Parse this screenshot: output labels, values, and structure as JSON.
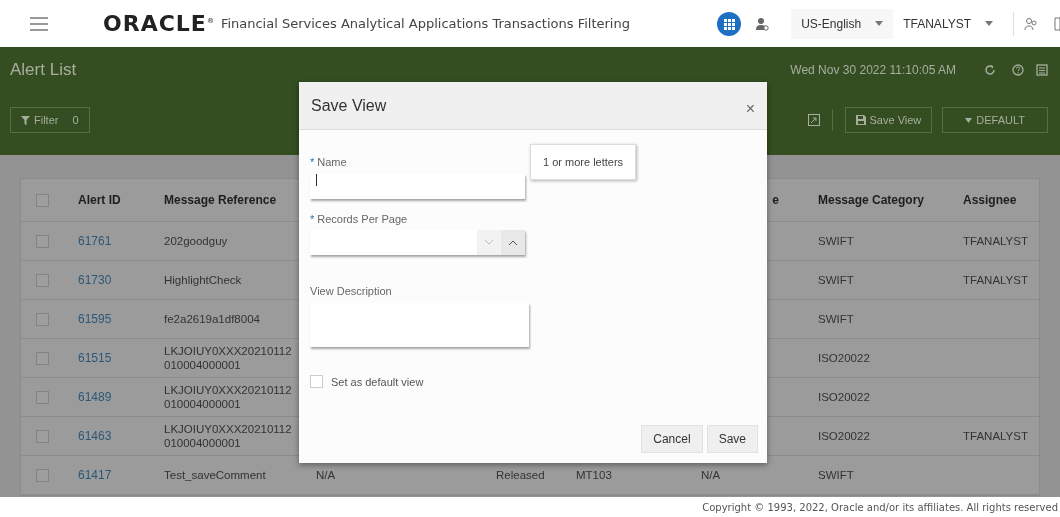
{
  "topbar": {
    "brand": "ORACLE$^{®}$",
    "app_title": "Financial Services Analytical Applications Transactions Filtering",
    "language": "US-English",
    "user": "TFANALYST"
  },
  "header": {
    "title": "Alert List",
    "datetime": "Wed Nov 30 2022 11:10:05 AM",
    "filter": {
      "label": "Filter",
      "count": "0"
    },
    "save_view": "Save View",
    "view_menu": "DEFAULT"
  },
  "table": {
    "select_all": {
      "checked": false
    },
    "columns": {
      "alert_id": "Alert ID",
      "message_reference": "Message Reference",
      "column_7": "e",
      "message_category": "Message Category",
      "assignee": "Assignee"
    },
    "rows": [
      {
        "checked": false,
        "alert_id": "61761",
        "message_reference": "202goodguy",
        "message_category": "SWIFT",
        "assignee": "TFANALYST"
      },
      {
        "checked": false,
        "alert_id": "61730",
        "message_reference": "HighlightCheck",
        "message_category": "SWIFT",
        "assignee": "TFANALYST"
      },
      {
        "checked": false,
        "alert_id": "61595",
        "message_reference": "fe2a2619a1df8004",
        "message_category": "SWIFT"
      },
      {
        "checked": false,
        "alert_id": "61515",
        "message_reference": "LKJOIUY0XXX20210112\n010004000001",
        "message_category": "ISO20022"
      },
      {
        "checked": false,
        "alert_id": "61489",
        "message_reference": "LKJOIUY0XXX20210112\n010004000001",
        "message_category": "ISO20022"
      },
      {
        "checked": false,
        "alert_id": "61463",
        "message_reference": "LKJOIUY0XXX20210112\n010004000001",
        "message_category": "ISO20022",
        "assignee": "TFANALYST"
      },
      {
        "checked": false,
        "alert_id": "61417",
        "message_reference": "Test_saveComment",
        "column_4": "N/A",
        "column_5": "Released",
        "column_6": "MT103",
        "column_7": "N/A",
        "message_category": "SWIFT"
      }
    ]
  },
  "dialog": {
    "title": "Save View",
    "close": "×",
    "name": {
      "label": "Name",
      "marker": "*",
      "tooltip": "1 or more letters"
    },
    "records_per_page": {
      "label": "Records Per Page",
      "marker": "*"
    },
    "description": {
      "label": "View Description"
    },
    "default_view": {
      "label": "Set as default view",
      "checked": false
    },
    "buttons": [
      "Cancel",
      "Save"
    ]
  },
  "footer": "Copyright © 1993, 2022, Oracle and/or its affiliates. All rights reserved"
}
